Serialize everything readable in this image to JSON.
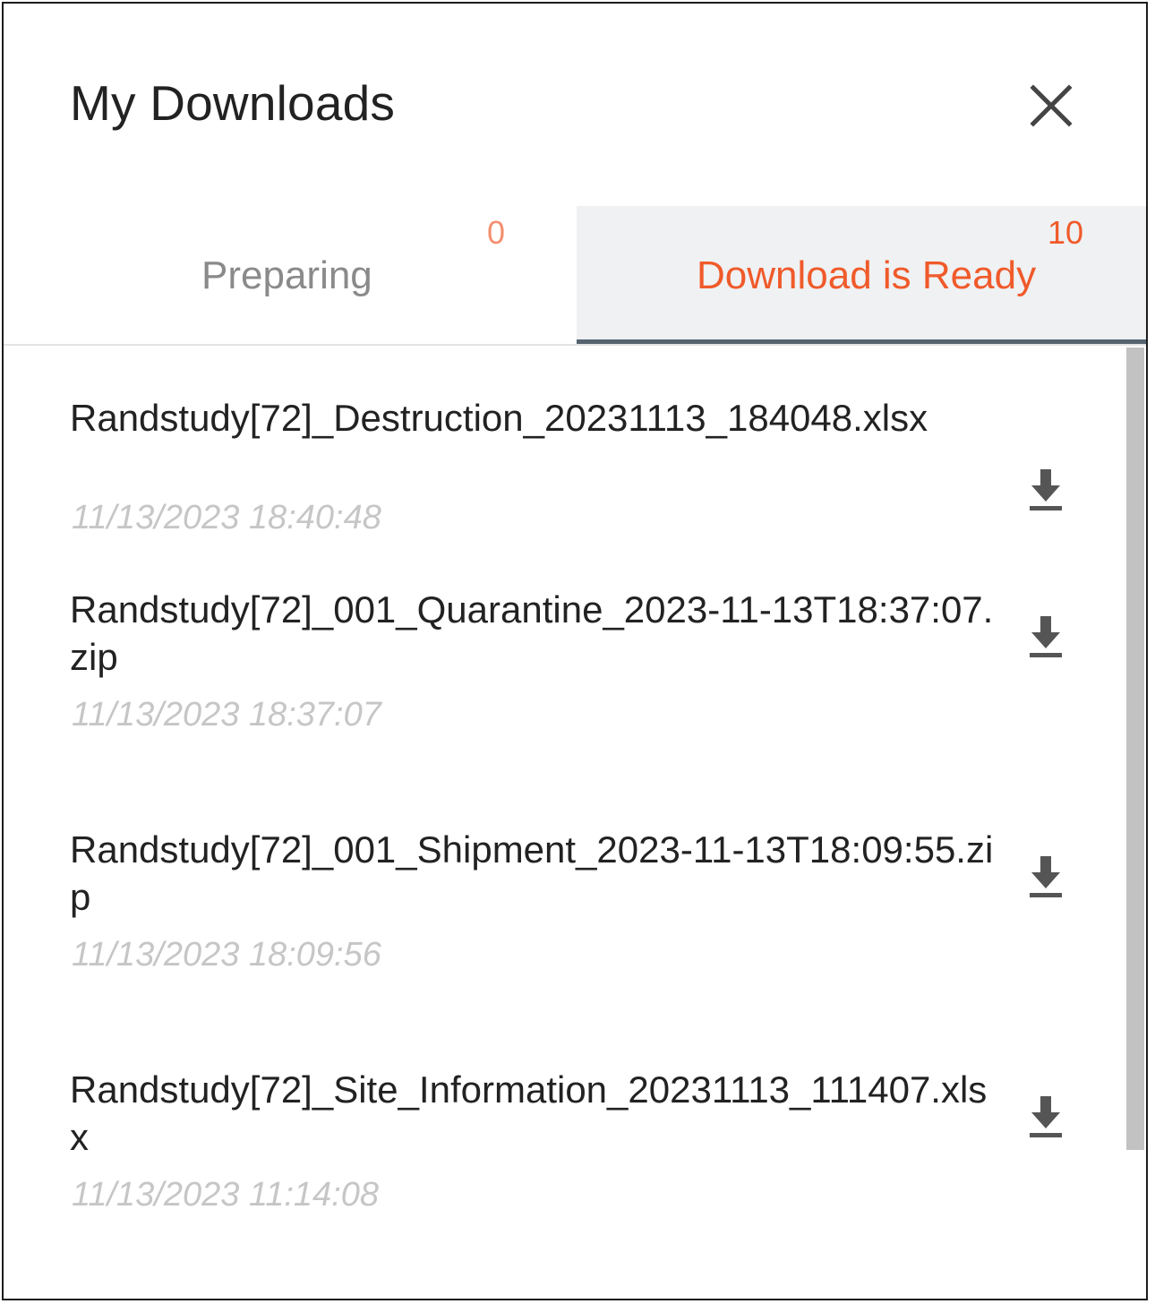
{
  "dialog": {
    "title": "My Downloads",
    "close_icon": "close-icon"
  },
  "tabs": [
    {
      "label": "Preparing",
      "count": "0",
      "active": false
    },
    {
      "label": "Download is Ready",
      "count": "10",
      "active": true
    }
  ],
  "colors": {
    "accent": "#f05a2a",
    "accent_light": "#f39070",
    "inactive_text": "#8a8a8a",
    "active_tab_bg": "#eff1f3",
    "active_tab_underline": "#556470",
    "timestamp": "#c6c6c6"
  },
  "downloads": [
    {
      "name": "Randstudy[72]_Destruction_20231113_184048.xlsx",
      "time": "11/13/2023 18:40:48",
      "icon": "download-icon"
    },
    {
      "name": "Randstudy[72]_001_Quarantine_2023-11-13T18:37:07.zip",
      "time": "11/13/2023 18:37:07",
      "icon": "download-icon"
    },
    {
      "name": "Randstudy[72]_001_Shipment_2023-11-13T18:09:55.zip",
      "time": "11/13/2023 18:09:56",
      "icon": "download-icon"
    },
    {
      "name": "Randstudy[72]_Site_Information_20231113_111407.xlsx",
      "time": "11/13/2023 11:14:08",
      "icon": "download-icon"
    }
  ]
}
